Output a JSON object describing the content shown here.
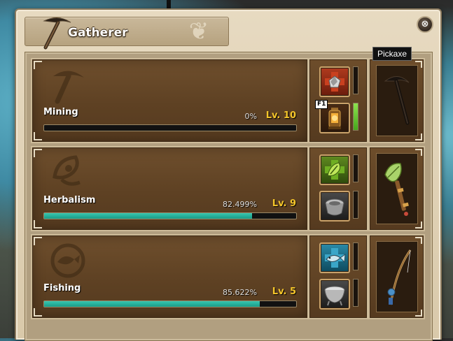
{
  "window": {
    "title": "Gatherer",
    "close_symbol": "⊗",
    "colors": {
      "level": "#f4c52a",
      "progress": "#2bb5a0",
      "frame": "#d9c9aa",
      "panel": "#5e4123"
    }
  },
  "tooltip": {
    "text": "Pickaxe"
  },
  "professions": [
    {
      "name": "Mining",
      "percent_text": "0%",
      "level_text": "Lv. 10",
      "progress": 0,
      "icon": "pickaxe-icon",
      "actions": [
        {
          "icon": "ore-node-icon",
          "slot_active": false
        },
        {
          "icon": "lantern-icon",
          "hotkey": "F1",
          "slot_active": true
        }
      ],
      "tool": "pickaxe-icon"
    },
    {
      "name": "Herbalism",
      "percent_text": "82.499%",
      "level_text": "Lv. 9",
      "progress": 0.82499,
      "icon": "herb-leaf-icon",
      "actions": [
        {
          "icon": "herb-node-icon",
          "slot_active": false
        },
        {
          "icon": "herb-pot-icon",
          "slot_active": false
        }
      ],
      "tool": "herb-sickle-icon"
    },
    {
      "name": "Fishing",
      "percent_text": "85.622%",
      "level_text": "Lv. 5",
      "progress": 0.85622,
      "icon": "fish-icon",
      "actions": [
        {
          "icon": "fish-node-icon",
          "slot_active": false
        },
        {
          "icon": "cooking-pot-icon",
          "slot_active": false
        }
      ],
      "tool": "fishing-rod-icon"
    }
  ]
}
